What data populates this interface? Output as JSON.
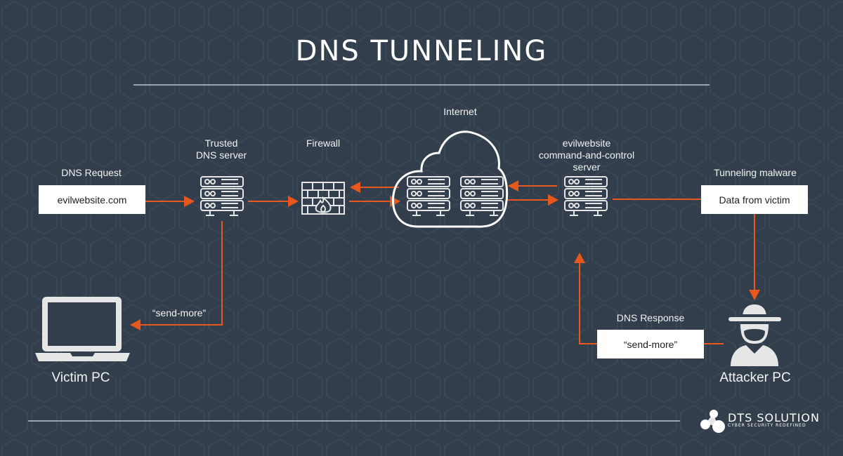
{
  "title": "DNS TUNNELING",
  "colors": {
    "background": "#323e4b",
    "accent_arrow": "#e8571b",
    "icon_stroke": "#e6e6e6",
    "box_fill": "#ffffff",
    "rule": "#9aa3ab"
  },
  "nodes": {
    "dns_request": {
      "label": "DNS Request",
      "box_text": "evilwebsite.com"
    },
    "trusted_dns": {
      "label_line1": "Trusted",
      "label_line2": "DNS server",
      "icon": "server-icon"
    },
    "firewall": {
      "label": "Firewall",
      "icon": "firewall-icon"
    },
    "internet": {
      "label": "Internet",
      "icon": "cloud-icon",
      "servers": 2
    },
    "c2_server": {
      "label_line1": "evilwebsite",
      "label_line2": "command-and-control",
      "label_line3": "server",
      "icon": "server-icon"
    },
    "tunneling_malware": {
      "label": "Tunneling malware",
      "box_text": "Data from victim"
    },
    "victim_pc": {
      "label": "Victim PC",
      "icon": "laptop-icon"
    },
    "attacker_pc": {
      "label": "Attacker PC",
      "icon": "hacker-icon"
    },
    "dns_response": {
      "label": "DNS Response",
      "box_text": "“send-more”"
    },
    "victim_message": {
      "text": "“send-more”"
    }
  },
  "logo": {
    "name": "DTS SOLUTION",
    "tagline": "CYBER SECURITY REDEFINED"
  }
}
